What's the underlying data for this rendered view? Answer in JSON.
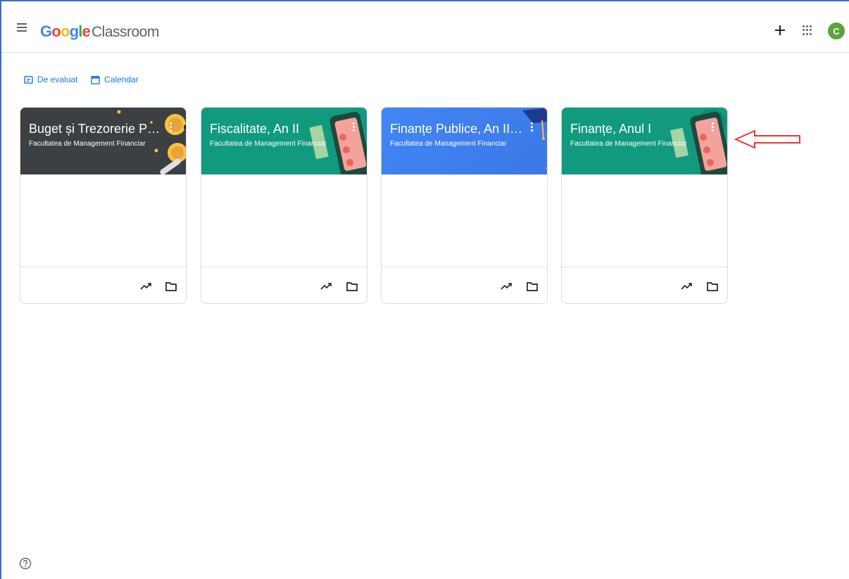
{
  "header": {
    "logo_google": [
      "G",
      "o",
      "o",
      "g",
      "l",
      "e"
    ],
    "logo_product": "Classroom",
    "avatar_letter": "C"
  },
  "quick_links": [
    {
      "label": "De evaluat",
      "icon": "review-icon"
    },
    {
      "label": "Calendar",
      "icon": "calendar-icon"
    }
  ],
  "cards": [
    {
      "title": "Buget și Trezorerie Pu...",
      "subtitle": "Facultatea de Management Financiar",
      "color": "#3c4043",
      "theme": "coins"
    },
    {
      "title": "Fiscalitate, An II",
      "subtitle": "Facultatea de Management Financiar",
      "color": "#129a7f",
      "theme": "phone"
    },
    {
      "title": "Finanțe Publice, An II ...",
      "subtitle": "Facultatea de Management Financiar",
      "color": "#4285f4",
      "theme": "graduation"
    },
    {
      "title": "Finanțe, Anul I",
      "subtitle": "Facultatea de Management Financiar",
      "color": "#129a7f",
      "theme": "phone"
    }
  ],
  "colors": {
    "accent": "#1a73e8",
    "annotation_arrow": "#e53935"
  }
}
